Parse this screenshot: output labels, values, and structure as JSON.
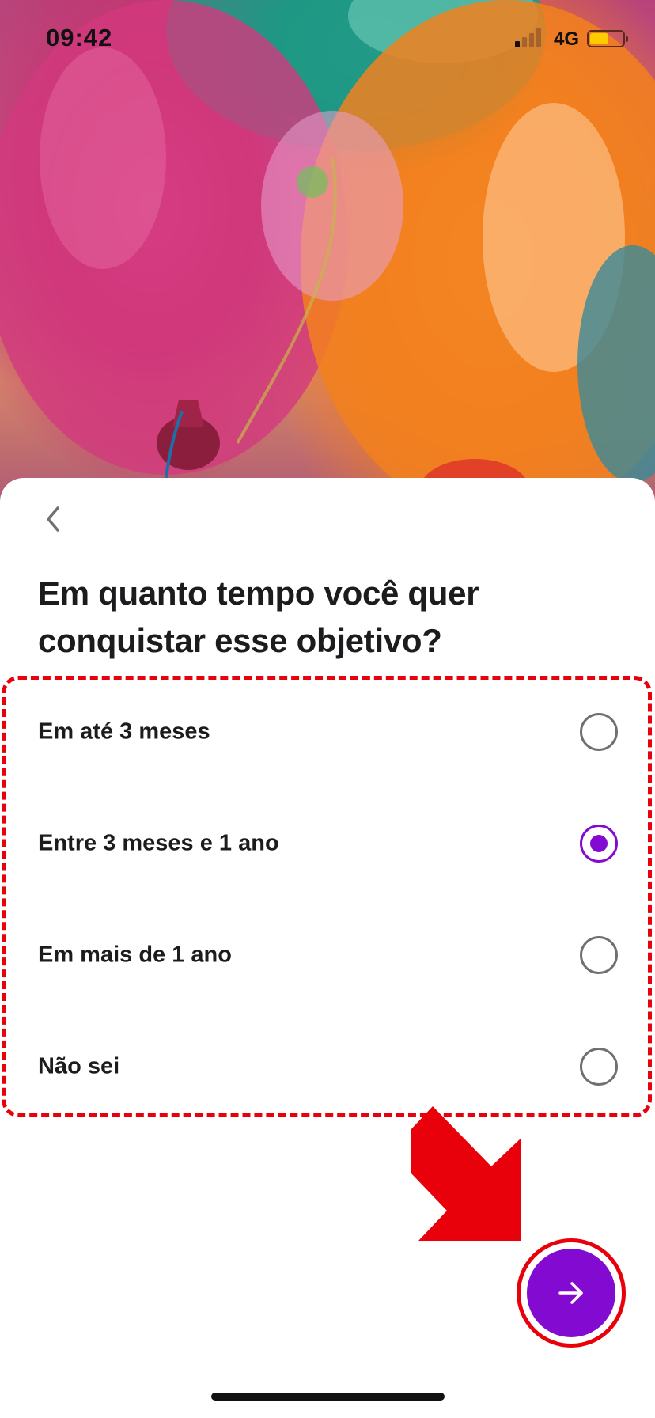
{
  "status_bar": {
    "time": "09:42",
    "network": "4G",
    "battery_level": 0.58
  },
  "question": {
    "title": "Em quanto tempo você quer conquistar esse objetivo?"
  },
  "options": [
    {
      "label": "Em até 3 meses",
      "selected": false
    },
    {
      "label": "Entre 3 meses e 1 ano",
      "selected": true
    },
    {
      "label": "Em mais de 1 ano",
      "selected": false
    },
    {
      "label": "Não sei",
      "selected": false
    }
  ],
  "icons": {
    "back": "chevron-left-icon",
    "next": "arrow-right-icon"
  },
  "colors": {
    "accent": "#820ad1",
    "annotation": "#e8000b",
    "radio_unselected": "#707070"
  }
}
